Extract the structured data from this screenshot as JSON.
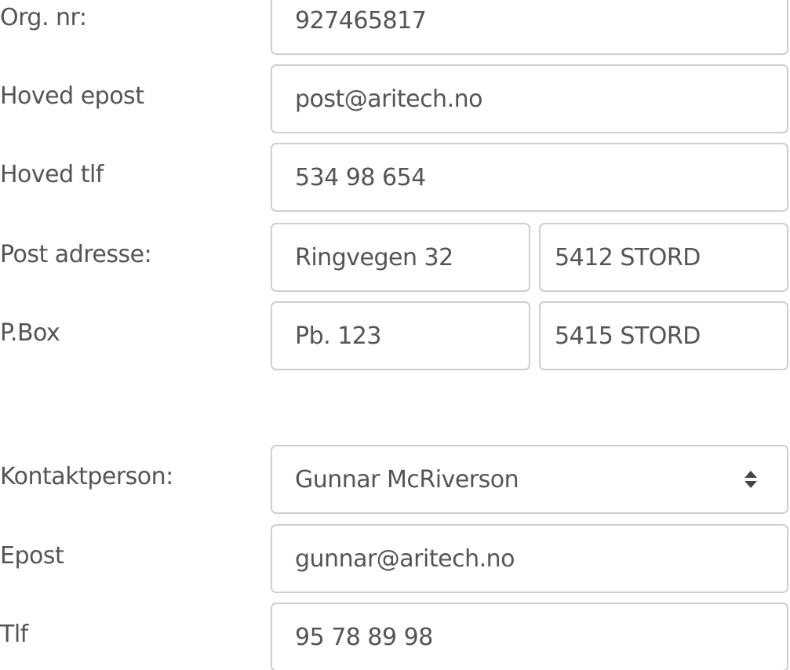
{
  "company": {
    "org_nr": {
      "label": "Org. nr:",
      "value": "927465817"
    },
    "main_email": {
      "label": "Hoved epost",
      "value": "post@aritech.no"
    },
    "main_phone": {
      "label": "Hoved tlf",
      "value": "534 98 654"
    },
    "postal_address": {
      "label": "Post adresse:",
      "street": "Ringvegen 32",
      "postal_city": "5412 STORD"
    },
    "po_box": {
      "label": "P.Box",
      "box": "Pb. 123",
      "postal_city": "5415 STORD"
    }
  },
  "contact": {
    "person": {
      "label": "Kontaktperson:",
      "selected": "Gunnar McRiverson",
      "icon": "select-arrows-icon"
    },
    "email": {
      "label": "Epost",
      "value": "gunnar@aritech.no"
    },
    "phone": {
      "label": "Tlf",
      "value": "95 78 89 98"
    }
  },
  "colors": {
    "text": "#555555",
    "border": "#cfcfcf",
    "background": "#ffffff"
  }
}
